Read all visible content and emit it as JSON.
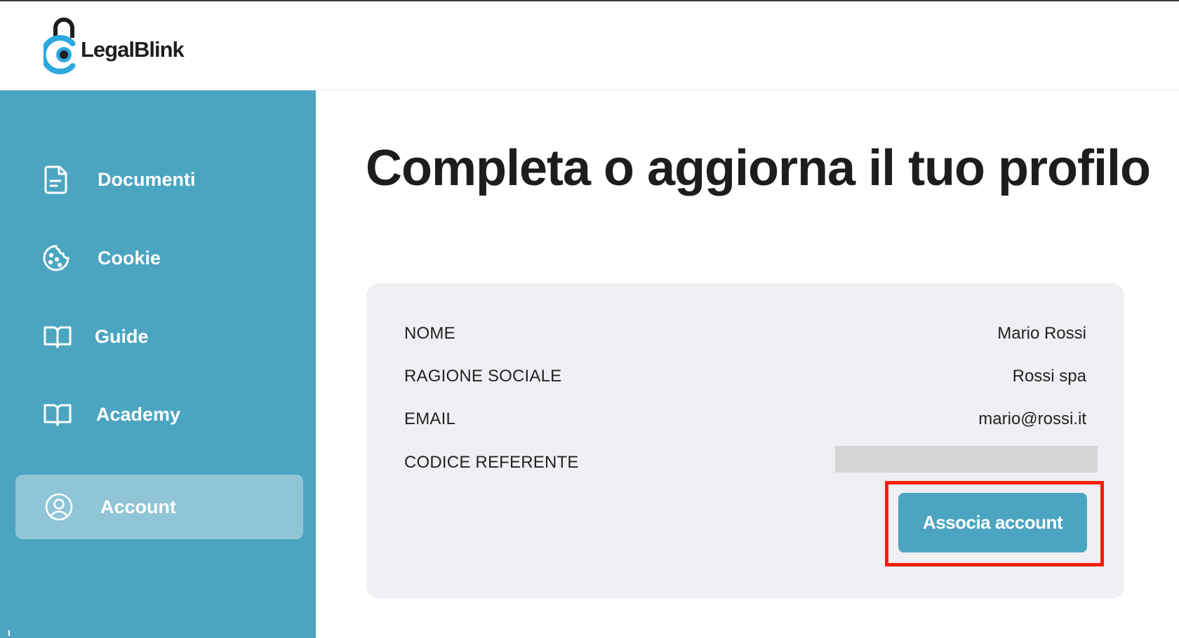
{
  "brand": {
    "name": "LegalBlink",
    "accent": "#4ba5c1",
    "logo_blue": "#2da7e0"
  },
  "sidebar": {
    "items": [
      {
        "label": "Documenti",
        "icon": "document-icon",
        "active": false
      },
      {
        "label": "Cookie",
        "icon": "cookie-icon",
        "active": false
      },
      {
        "label": "Guide",
        "icon": "book-icon",
        "active": false
      },
      {
        "label": "Academy",
        "icon": "book-icon",
        "active": false
      },
      {
        "label": "Account",
        "icon": "user-circle-icon",
        "active": true
      }
    ]
  },
  "main": {
    "title": "Completa o aggiorna il tuo profilo",
    "profile": {
      "fields": [
        {
          "label": "NOME",
          "value": "Mario Rossi"
        },
        {
          "label": "RAGIONE SOCIALE",
          "value": "Rossi spa"
        },
        {
          "label": "EMAIL",
          "value": "mario@rossi.it"
        },
        {
          "label": "CODICE REFERENTE",
          "value": ""
        }
      ],
      "button_label": "Associa account"
    }
  },
  "annotation": {
    "highlight_color": "#f5230b"
  }
}
